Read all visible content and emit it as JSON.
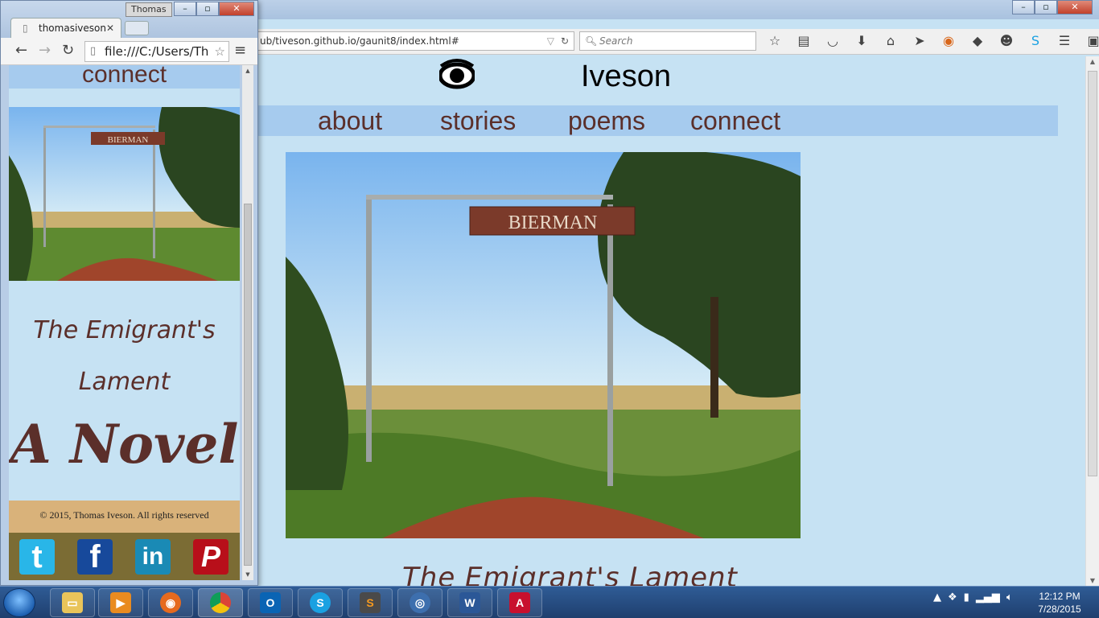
{
  "firefox": {
    "url": "ub/tiveson.github.io/gaunit8/index.html#",
    "search_placeholder": "Search",
    "site_title": "Iveson",
    "nav": [
      "about",
      "stories",
      "poems",
      "connect"
    ],
    "hero_sign": "BIERMAN",
    "lament_heading": "The Emigrant's Lament"
  },
  "chrome": {
    "user_button": "Thomas",
    "tab_title": "thomasiveson",
    "omnibox": "file:///C:/Users/Th",
    "connect_label": "connect",
    "hero_sign": "BIERMAN",
    "lament_line1": "The Emigrant's",
    "lament_line2": "Lament",
    "novel": "A Novel",
    "footer": "© 2015, Thomas Iveson. All rights reserved",
    "social": [
      {
        "name": "twitter",
        "glyph": "t",
        "color": "#29b6e8"
      },
      {
        "name": "facebook",
        "glyph": "f",
        "color": "#17499b"
      },
      {
        "name": "linkedin",
        "glyph": "in",
        "color": "#1a8ab5"
      },
      {
        "name": "pinterest",
        "glyph": "P",
        "color": "#b80f1a"
      }
    ]
  },
  "taskbar": {
    "apps": [
      "explorer",
      "media-player",
      "firefox",
      "chrome",
      "outlook",
      "skype",
      "sublime-text",
      "network-app",
      "word",
      "acrobat"
    ],
    "time": "12:12 PM",
    "date": "7/28/2015"
  }
}
